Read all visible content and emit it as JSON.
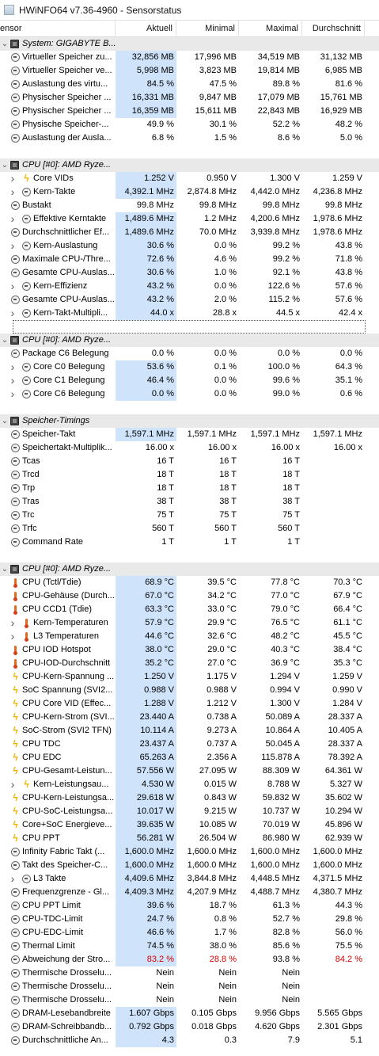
{
  "window": {
    "title": "HWiNFO64 v7.36-4960 - Sensorstatus"
  },
  "columns": {
    "sensor": "ensor",
    "current": "Aktuell",
    "min": "Minimal",
    "max": "Maximal",
    "avg": "Durchschnitt"
  },
  "rows": [
    {
      "kind": "group",
      "indent": 0,
      "icon": "chip",
      "label": "System: GIGABYTE B..."
    },
    {
      "kind": "sensor",
      "indent": 0,
      "icon": "clock",
      "label": "Virtueller Speicher zu...",
      "cur": "32,856 MB",
      "min": "17,996 MB",
      "max": "34,519 MB",
      "avg": "31,132 MB",
      "hl": true
    },
    {
      "kind": "sensor",
      "indent": 0,
      "icon": "clock",
      "label": "Virtueller Speicher ve...",
      "cur": "5,998 MB",
      "min": "3,823 MB",
      "max": "19,814 MB",
      "avg": "6,985 MB",
      "hl": true
    },
    {
      "kind": "sensor",
      "indent": 0,
      "icon": "clock",
      "label": "Auslastung des virtu...",
      "cur": "84.5 %",
      "min": "47.5 %",
      "max": "89.8 %",
      "avg": "81.6 %",
      "hl": true
    },
    {
      "kind": "sensor",
      "indent": 0,
      "icon": "clock",
      "label": "Physischer Speicher ...",
      "cur": "16,331 MB",
      "min": "9,847 MB",
      "max": "17,079 MB",
      "avg": "15,761 MB",
      "hl": true
    },
    {
      "kind": "sensor",
      "indent": 0,
      "icon": "clock",
      "label": "Physischer Speicher ...",
      "cur": "16,359 MB",
      "min": "15,611 MB",
      "max": "22,843 MB",
      "avg": "16,929 MB",
      "hl": true
    },
    {
      "kind": "sensor",
      "indent": 0,
      "icon": "clock",
      "label": "Physische Speicher-...",
      "cur": "49.9 %",
      "min": "30.1 %",
      "max": "52.2 %",
      "avg": "48.2 %",
      "hl": false
    },
    {
      "kind": "sensor",
      "indent": 0,
      "icon": "clock",
      "label": "Auslastung der Ausla...",
      "cur": "6.8 %",
      "min": "1.5 %",
      "max": "8.6 %",
      "avg": "5.0 %",
      "hl": false
    },
    {
      "kind": "blank"
    },
    {
      "kind": "group",
      "indent": 0,
      "icon": "chip",
      "label": "CPU [#0]: AMD Ryze..."
    },
    {
      "kind": "sensor",
      "indent": 1,
      "icon": "bolt",
      "label": "Core VIDs",
      "cur": "1.252 V",
      "min": "0.950 V",
      "max": "1.300 V",
      "avg": "1.259 V",
      "hl": true
    },
    {
      "kind": "sensor",
      "indent": 1,
      "icon": "clock",
      "label": "Kern-Takte",
      "cur": "4,392.1 MHz",
      "min": "2,874.8 MHz",
      "max": "4,442.0 MHz",
      "avg": "4,236.8 MHz",
      "hl": true
    },
    {
      "kind": "sensor",
      "indent": 0,
      "icon": "clock",
      "label": "Bustakt",
      "cur": "99.8 MHz",
      "min": "99.8 MHz",
      "max": "99.8 MHz",
      "avg": "99.8 MHz",
      "hl": false
    },
    {
      "kind": "sensor",
      "indent": 1,
      "icon": "clock",
      "label": "Effektive Kerntakte",
      "cur": "1,489.6 MHz",
      "min": "1.2 MHz",
      "max": "4,200.6 MHz",
      "avg": "1,978.6 MHz",
      "hl": true
    },
    {
      "kind": "sensor",
      "indent": 0,
      "icon": "clock",
      "label": "Durchschnittlicher Ef...",
      "cur": "1,489.6 MHz",
      "min": "70.0 MHz",
      "max": "3,939.8 MHz",
      "avg": "1,978.6 MHz",
      "hl": true
    },
    {
      "kind": "sensor",
      "indent": 1,
      "icon": "clock",
      "label": "Kern-Auslastung",
      "cur": "30.6 %",
      "min": "0.0 %",
      "max": "99.2 %",
      "avg": "43.8 %",
      "hl": true
    },
    {
      "kind": "sensor",
      "indent": 0,
      "icon": "clock",
      "label": "Maximale CPU-/Thre...",
      "cur": "72.6 %",
      "min": "4.6 %",
      "max": "99.2 %",
      "avg": "71.8 %",
      "hl": true
    },
    {
      "kind": "sensor",
      "indent": 0,
      "icon": "clock",
      "label": "Gesamte CPU-Auslas...",
      "cur": "30.6 %",
      "min": "1.0 %",
      "max": "92.1 %",
      "avg": "43.8 %",
      "hl": true
    },
    {
      "kind": "sensor",
      "indent": 1,
      "icon": "clock",
      "label": "Kern-Effizienz",
      "cur": "43.2 %",
      "min": "0.0 %",
      "max": "122.6 %",
      "avg": "57.6 %",
      "hl": true
    },
    {
      "kind": "sensor",
      "indent": 0,
      "icon": "clock",
      "label": "Gesamte CPU-Auslas...",
      "cur": "43.2 %",
      "min": "2.0 %",
      "max": "115.2 %",
      "avg": "57.6 %",
      "hl": true
    },
    {
      "kind": "sensor",
      "indent": 1,
      "icon": "clock",
      "label": "Kern-Takt-Multipli...",
      "cur": "44.0 x",
      "min": "28.8 x",
      "max": "44.5 x",
      "avg": "42.4 x",
      "hl": true
    },
    {
      "kind": "blank",
      "dotted": true
    },
    {
      "kind": "group",
      "indent": 0,
      "icon": "chip",
      "label": "CPU [#0]: AMD Ryze..."
    },
    {
      "kind": "sensor",
      "indent": 0,
      "icon": "clock",
      "label": "Package C6 Belegung",
      "cur": "0.0 %",
      "min": "0.0 %",
      "max": "0.0 %",
      "avg": "0.0 %",
      "hl": false
    },
    {
      "kind": "sensor",
      "indent": 1,
      "icon": "clock",
      "label": "Core C0 Belegung",
      "cur": "53.6 %",
      "min": "0.1 %",
      "max": "100.0 %",
      "avg": "64.3 %",
      "hl": true
    },
    {
      "kind": "sensor",
      "indent": 1,
      "icon": "clock",
      "label": "Core C1 Belegung",
      "cur": "46.4 %",
      "min": "0.0 %",
      "max": "99.6 %",
      "avg": "35.1 %",
      "hl": true
    },
    {
      "kind": "sensor",
      "indent": 1,
      "icon": "clock",
      "label": "Core C6 Belegung",
      "cur": "0.0 %",
      "min": "0.0 %",
      "max": "99.0 %",
      "avg": "0.6 %",
      "hl": true
    },
    {
      "kind": "blank"
    },
    {
      "kind": "group",
      "indent": 0,
      "icon": "chip",
      "label": "Speicher-Timings"
    },
    {
      "kind": "sensor",
      "indent": 0,
      "icon": "clock",
      "label": "Speicher-Takt",
      "cur": "1,597.1 MHz",
      "min": "1,597.1 MHz",
      "max": "1,597.1 MHz",
      "avg": "1,597.1 MHz",
      "hl": true
    },
    {
      "kind": "sensor",
      "indent": 0,
      "icon": "clock",
      "label": "Speichertakt-Multiplik...",
      "cur": "16.00 x",
      "min": "16.00 x",
      "max": "16.00 x",
      "avg": "16.00 x",
      "hl": false
    },
    {
      "kind": "sensor",
      "indent": 0,
      "icon": "clock",
      "label": "Tcas",
      "cur": "16 T",
      "min": "16 T",
      "max": "16 T",
      "avg": "",
      "hl": false
    },
    {
      "kind": "sensor",
      "indent": 0,
      "icon": "clock",
      "label": "Trcd",
      "cur": "18 T",
      "min": "18 T",
      "max": "18 T",
      "avg": "",
      "hl": false
    },
    {
      "kind": "sensor",
      "indent": 0,
      "icon": "clock",
      "label": "Trp",
      "cur": "18 T",
      "min": "18 T",
      "max": "18 T",
      "avg": "",
      "hl": false
    },
    {
      "kind": "sensor",
      "indent": 0,
      "icon": "clock",
      "label": "Tras",
      "cur": "38 T",
      "min": "38 T",
      "max": "38 T",
      "avg": "",
      "hl": false
    },
    {
      "kind": "sensor",
      "indent": 0,
      "icon": "clock",
      "label": "Trc",
      "cur": "75 T",
      "min": "75 T",
      "max": "75 T",
      "avg": "",
      "hl": false
    },
    {
      "kind": "sensor",
      "indent": 0,
      "icon": "clock",
      "label": "Trfc",
      "cur": "560 T",
      "min": "560 T",
      "max": "560 T",
      "avg": "",
      "hl": false
    },
    {
      "kind": "sensor",
      "indent": 0,
      "icon": "clock",
      "label": "Command Rate",
      "cur": "1 T",
      "min": "1 T",
      "max": "1 T",
      "avg": "",
      "hl": false
    },
    {
      "kind": "blank"
    },
    {
      "kind": "group",
      "indent": 0,
      "icon": "chip",
      "label": "CPU [#0]: AMD Ryze..."
    },
    {
      "kind": "sensor",
      "indent": 0,
      "icon": "therm",
      "label": "CPU (Tctl/Tdie)",
      "cur": "68.9 °C",
      "min": "39.5 °C",
      "max": "77.8 °C",
      "avg": "70.3 °C",
      "hl": true
    },
    {
      "kind": "sensor",
      "indent": 0,
      "icon": "therm",
      "label": "CPU-Gehäuse (Durch...",
      "cur": "67.0 °C",
      "min": "34.2 °C",
      "max": "77.0 °C",
      "avg": "67.9 °C",
      "hl": true
    },
    {
      "kind": "sensor",
      "indent": 0,
      "icon": "therm",
      "label": "CPU CCD1 (Tdie)",
      "cur": "63.3 °C",
      "min": "33.0 °C",
      "max": "79.0 °C",
      "avg": "66.4 °C",
      "hl": true
    },
    {
      "kind": "sensor",
      "indent": 1,
      "icon": "therm",
      "label": "Kern-Temperaturen",
      "cur": "57.9 °C",
      "min": "29.9 °C",
      "max": "76.5 °C",
      "avg": "61.1 °C",
      "hl": true
    },
    {
      "kind": "sensor",
      "indent": 1,
      "icon": "therm",
      "label": "L3 Temperaturen",
      "cur": "44.6 °C",
      "min": "32.6 °C",
      "max": "48.2 °C",
      "avg": "45.5 °C",
      "hl": true
    },
    {
      "kind": "sensor",
      "indent": 0,
      "icon": "therm",
      "label": "CPU IOD Hotspot",
      "cur": "38.0 °C",
      "min": "29.0 °C",
      "max": "40.3 °C",
      "avg": "38.4 °C",
      "hl": true
    },
    {
      "kind": "sensor",
      "indent": 0,
      "icon": "therm",
      "label": "CPU-IOD-Durchschnitt",
      "cur": "35.2 °C",
      "min": "27.0 °C",
      "max": "36.9 °C",
      "avg": "35.3 °C",
      "hl": true
    },
    {
      "kind": "sensor",
      "indent": 0,
      "icon": "bolt",
      "label": "CPU-Kern-Spannung ...",
      "cur": "1.250 V",
      "min": "1.175 V",
      "max": "1.294 V",
      "avg": "1.259 V",
      "hl": true
    },
    {
      "kind": "sensor",
      "indent": 0,
      "icon": "bolt",
      "label": "SoC Spannung (SVI2...",
      "cur": "0.988 V",
      "min": "0.988 V",
      "max": "0.994 V",
      "avg": "0.990 V",
      "hl": true
    },
    {
      "kind": "sensor",
      "indent": 0,
      "icon": "bolt",
      "label": "CPU Core VID (Effec...",
      "cur": "1.288 V",
      "min": "1.212 V",
      "max": "1.300 V",
      "avg": "1.284 V",
      "hl": true
    },
    {
      "kind": "sensor",
      "indent": 0,
      "icon": "bolt",
      "label": "CPU-Kern-Strom (SVI...",
      "cur": "23.440 A",
      "min": "0.738 A",
      "max": "50.089 A",
      "avg": "28.337 A",
      "hl": true
    },
    {
      "kind": "sensor",
      "indent": 0,
      "icon": "bolt",
      "label": "SoC-Strom (SVI2 TFN)",
      "cur": "10.114 A",
      "min": "9.273 A",
      "max": "10.864 A",
      "avg": "10.405 A",
      "hl": true
    },
    {
      "kind": "sensor",
      "indent": 0,
      "icon": "bolt",
      "label": "CPU TDC",
      "cur": "23.437 A",
      "min": "0.737 A",
      "max": "50.045 A",
      "avg": "28.337 A",
      "hl": true
    },
    {
      "kind": "sensor",
      "indent": 0,
      "icon": "bolt",
      "label": "CPU EDC",
      "cur": "65.263 A",
      "min": "2.356 A",
      "max": "115.878 A",
      "avg": "78.392 A",
      "hl": true
    },
    {
      "kind": "sensor",
      "indent": 0,
      "icon": "bolt",
      "label": "CPU-Gesamt-Leistun...",
      "cur": "57.556 W",
      "min": "27.095 W",
      "max": "88.309 W",
      "avg": "64.361 W",
      "hl": true
    },
    {
      "kind": "sensor",
      "indent": 1,
      "icon": "bolt",
      "label": "Kern-Leistungsau...",
      "cur": "4.530 W",
      "min": "0.015 W",
      "max": "8.788 W",
      "avg": "5.327 W",
      "hl": true
    },
    {
      "kind": "sensor",
      "indent": 0,
      "icon": "bolt",
      "label": "CPU-Kern-Leistungsa...",
      "cur": "29.618 W",
      "min": "0.843 W",
      "max": "59.832 W",
      "avg": "35.602 W",
      "hl": true
    },
    {
      "kind": "sensor",
      "indent": 0,
      "icon": "bolt",
      "label": "CPU-SoC-Leistungsa...",
      "cur": "10.017 W",
      "min": "9.215 W",
      "max": "10.737 W",
      "avg": "10.294 W",
      "hl": true
    },
    {
      "kind": "sensor",
      "indent": 0,
      "icon": "bolt",
      "label": "Core+SoC Energieve...",
      "cur": "39.635 W",
      "min": "10.085 W",
      "max": "70.019 W",
      "avg": "45.896 W",
      "hl": true
    },
    {
      "kind": "sensor",
      "indent": 0,
      "icon": "bolt",
      "label": "CPU PPT",
      "cur": "56.281 W",
      "min": "26.504 W",
      "max": "86.980 W",
      "avg": "62.939 W",
      "hl": true
    },
    {
      "kind": "sensor",
      "indent": 0,
      "icon": "clock",
      "label": "Infinity Fabric Takt (...",
      "cur": "1,600.0 MHz",
      "min": "1,600.0 MHz",
      "max": "1,600.0 MHz",
      "avg": "1,600.0 MHz",
      "hl": true
    },
    {
      "kind": "sensor",
      "indent": 0,
      "icon": "clock",
      "label": "Takt des Speicher-C...",
      "cur": "1,600.0 MHz",
      "min": "1,600.0 MHz",
      "max": "1,600.0 MHz",
      "avg": "1,600.0 MHz",
      "hl": true
    },
    {
      "kind": "sensor",
      "indent": 1,
      "icon": "clock",
      "label": "L3 Takte",
      "cur": "4,409.6 MHz",
      "min": "3,844.8 MHz",
      "max": "4,448.5 MHz",
      "avg": "4,371.5 MHz",
      "hl": true
    },
    {
      "kind": "sensor",
      "indent": 0,
      "icon": "clock",
      "label": "Frequenzgrenze - Gl...",
      "cur": "4,409.3 MHz",
      "min": "4,207.9 MHz",
      "max": "4,488.7 MHz",
      "avg": "4,380.7 MHz",
      "hl": true
    },
    {
      "kind": "sensor",
      "indent": 0,
      "icon": "clock",
      "label": "CPU PPT Limit",
      "cur": "39.6 %",
      "min": "18.7 %",
      "max": "61.3 %",
      "avg": "44.3 %",
      "hl": true
    },
    {
      "kind": "sensor",
      "indent": 0,
      "icon": "clock",
      "label": "CPU-TDC-Limit",
      "cur": "24.7 %",
      "min": "0.8 %",
      "max": "52.7 %",
      "avg": "29.8 %",
      "hl": true
    },
    {
      "kind": "sensor",
      "indent": 0,
      "icon": "clock",
      "label": "CPU-EDC-Limit",
      "cur": "46.6 %",
      "min": "1.7 %",
      "max": "82.8 %",
      "avg": "56.0 %",
      "hl": true
    },
    {
      "kind": "sensor",
      "indent": 0,
      "icon": "clock",
      "label": "Thermal Limit",
      "cur": "74.5 %",
      "min": "38.0 %",
      "max": "85.6 %",
      "avg": "75.5 %",
      "hl": true
    },
    {
      "kind": "sensor",
      "indent": 0,
      "icon": "clock",
      "label": "Abweichung der Stro...",
      "cur": "83.2 %",
      "min": "28.8 %",
      "max": "93.8 %",
      "avg": "84.2 %",
      "hl": true,
      "red": true
    },
    {
      "kind": "sensor",
      "indent": 0,
      "icon": "clock",
      "label": "Thermische Drosselu...",
      "cur": "Nein",
      "min": "Nein",
      "max": "Nein",
      "avg": "",
      "hl": false
    },
    {
      "kind": "sensor",
      "indent": 0,
      "icon": "clock",
      "label": "Thermische Drosselu...",
      "cur": "Nein",
      "min": "Nein",
      "max": "Nein",
      "avg": "",
      "hl": false
    },
    {
      "kind": "sensor",
      "indent": 0,
      "icon": "clock",
      "label": "Thermische Drosselu...",
      "cur": "Nein",
      "min": "Nein",
      "max": "Nein",
      "avg": "",
      "hl": false
    },
    {
      "kind": "sensor",
      "indent": 0,
      "icon": "clock",
      "label": "DRAM-Lesebandbreite",
      "cur": "1.607 Gbps",
      "min": "0.105 Gbps",
      "max": "9.956 Gbps",
      "avg": "5.565 Gbps",
      "hl": true
    },
    {
      "kind": "sensor",
      "indent": 0,
      "icon": "clock",
      "label": "DRAM-Schreibbandb...",
      "cur": "0.792 Gbps",
      "min": "0.018 Gbps",
      "max": "4.620 Gbps",
      "avg": "2.301 Gbps",
      "hl": true
    },
    {
      "kind": "sensor",
      "indent": 0,
      "icon": "clock",
      "label": "Durchschnittliche An...",
      "cur": "4.3",
      "min": "0.3",
      "max": "7.9",
      "avg": "5.1",
      "hl": true
    }
  ]
}
